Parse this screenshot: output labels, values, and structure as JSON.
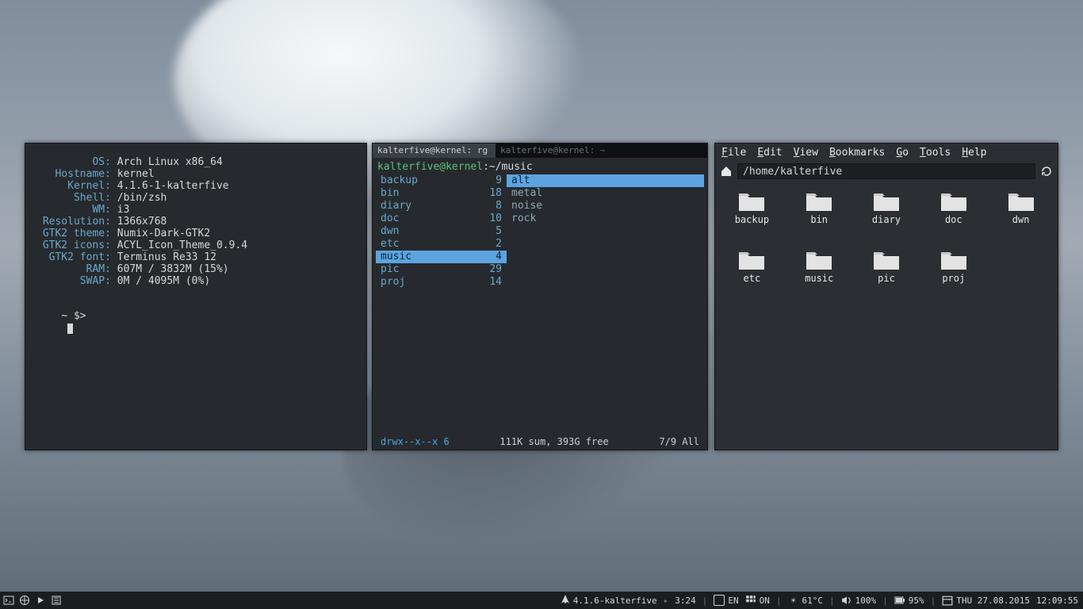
{
  "sysinfo": {
    "rows": [
      {
        "k": "OS",
        "v": "Arch Linux x86_64"
      },
      {
        "k": "Hostname",
        "v": "kernel"
      },
      {
        "k": "Kernel",
        "v": "4.1.6-1-kalterfive"
      },
      {
        "k": "Shell",
        "v": "/bin/zsh"
      },
      {
        "k": "WM",
        "v": "i3"
      },
      {
        "k": "Resolution",
        "v": "1366x768"
      },
      {
        "k": "GTK2 theme",
        "v": "Numix-Dark-GTK2"
      },
      {
        "k": "GTK2 icons",
        "v": "ACYL_Icon_Theme_0.9.4"
      },
      {
        "k": "GTK2 font",
        "v": "Terminus Re33 12"
      },
      {
        "k": "RAM",
        "v": "607M / 3832M (15%)"
      },
      {
        "k": "SWAP",
        "v": "0M / 4095M (0%)"
      }
    ],
    "prompt": "~ $>"
  },
  "ranger": {
    "tabs": [
      {
        "label": "kalterfive@kernel: rg",
        "active": true
      },
      {
        "label": "kalterfive@kernel: ~",
        "active": false
      }
    ],
    "user": "kalterfive@kernel",
    "path": ":~/music",
    "left": [
      {
        "name": "backup",
        "count": "9"
      },
      {
        "name": "bin",
        "count": "18"
      },
      {
        "name": "diary",
        "count": "8"
      },
      {
        "name": "doc",
        "count": "10"
      },
      {
        "name": "dwn",
        "count": "5"
      },
      {
        "name": "etc",
        "count": "2"
      },
      {
        "name": "music",
        "count": "4",
        "sel": true
      },
      {
        "name": "pic",
        "count": "29"
      },
      {
        "name": "proj",
        "count": "14"
      }
    ],
    "right": [
      {
        "name": "alt",
        "sel": true
      },
      {
        "name": "metal"
      },
      {
        "name": "noise"
      },
      {
        "name": "rock"
      }
    ],
    "status": {
      "perm": "drwx--x--x 6",
      "mid": "111K sum, 393G free",
      "pos": "7/9  All"
    }
  },
  "fm": {
    "menu": [
      "File",
      "Edit",
      "View",
      "Bookmarks",
      "Go",
      "Tools",
      "Help"
    ],
    "location": "/home/kalterfive",
    "items": [
      "backup",
      "bin",
      "diary",
      "doc",
      "dwn",
      "etc",
      "music",
      "pic",
      "proj"
    ]
  },
  "bar": {
    "kernel": "4.1.6-kalterfive",
    "uptime": "3:24",
    "lang": "EN",
    "kb": "ON",
    "temp": "61°C",
    "vol": "100%",
    "bat": "95%",
    "date": "THU 27.08.2015",
    "time": "12:09:55"
  }
}
